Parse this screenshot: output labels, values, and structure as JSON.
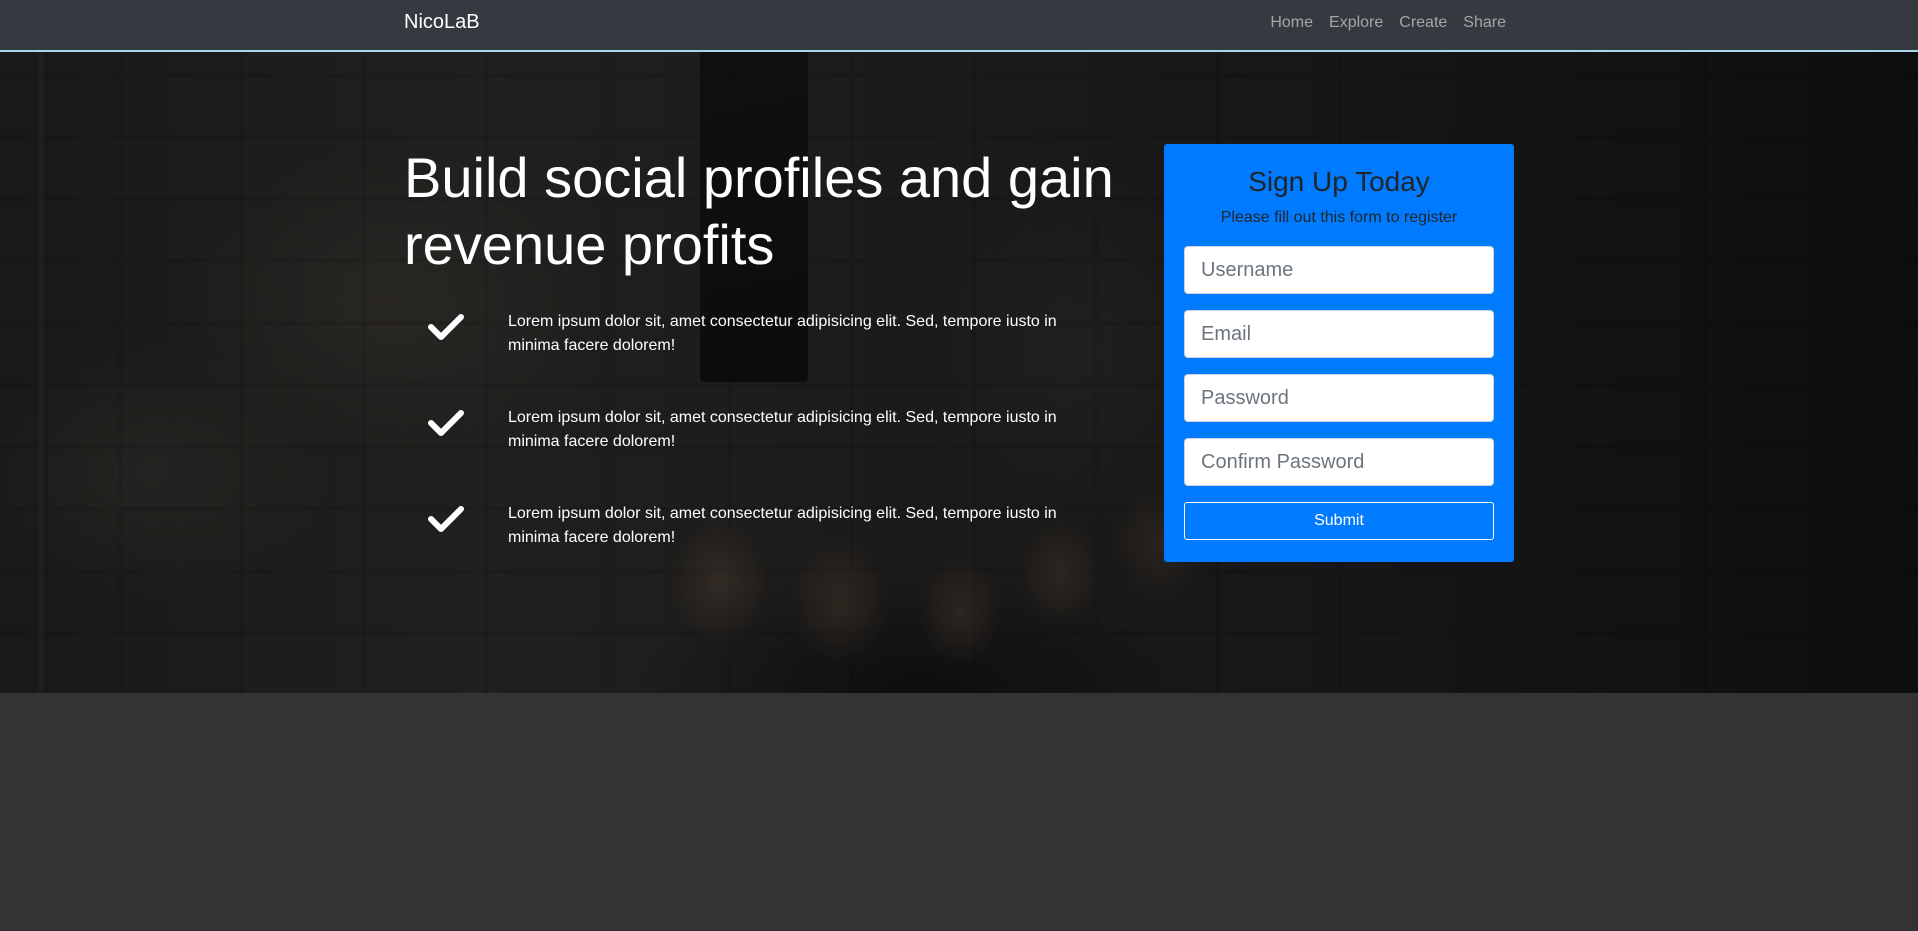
{
  "navbar": {
    "brand": "NicoLaB",
    "links": [
      "Home",
      "Explore",
      "Create",
      "Share"
    ]
  },
  "hero": {
    "headline": "Build social profiles and gain revenue profits",
    "features": [
      {
        "icon": "check-icon",
        "text": "Lorem ipsum dolor sit, amet consectetur adipisicing elit. Sed, tempore iusto in minima facere dolorem!"
      },
      {
        "icon": "check-icon",
        "text": "Lorem ipsum dolor sit, amet consectetur adipisicing elit. Sed, tempore iusto in minima facere dolorem!"
      },
      {
        "icon": "check-icon",
        "text": "Lorem ipsum dolor sit, amet consectetur adipisicing elit. Sed, tempore iusto in minima facere dolorem!"
      }
    ]
  },
  "signup": {
    "title": "Sign Up Today",
    "subtitle": "Please fill out this form to register",
    "fields": {
      "username": {
        "placeholder": "Username",
        "value": ""
      },
      "email": {
        "placeholder": "Email",
        "value": ""
      },
      "password": {
        "placeholder": "Password",
        "value": ""
      },
      "confirm_password": {
        "placeholder": "Confirm Password",
        "value": ""
      }
    },
    "submit_label": "Submit"
  },
  "colors": {
    "navbar_bg": "#343a40",
    "navbar_border": "#a9d9e6",
    "card_bg": "#007bff",
    "page_bg": "#333333"
  }
}
